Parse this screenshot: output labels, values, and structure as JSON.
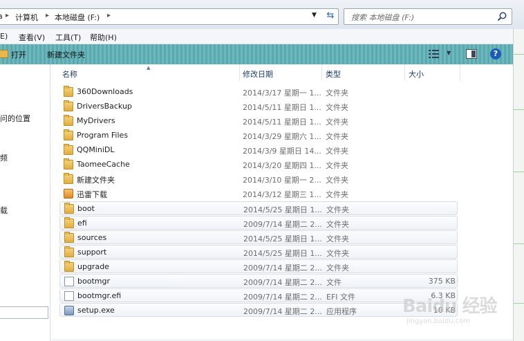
{
  "address_bar": {
    "segments": [
      "计算机",
      "本地磁盘 (F:)"
    ],
    "search_placeholder": "搜索 本地磁盘 (F:)",
    "partial_left": "a"
  },
  "menu": [
    "E)",
    "查看(V)",
    "工具(T)",
    "帮助(H)"
  ],
  "toolbar": {
    "open_label": "打开",
    "new_folder_label": "新建文件夹"
  },
  "nav_pane": [
    "问的位置",
    "频",
    "载"
  ],
  "columns": {
    "name": "名称",
    "date": "修改日期",
    "type": "类型",
    "size": "大小"
  },
  "files": [
    {
      "name": "360Downloads",
      "date": "2014/3/17 星期一 1...",
      "type": "文件夹",
      "size": "",
      "icon": "folder-icon",
      "selected": false
    },
    {
      "name": "DriversBackup",
      "date": "2014/5/11 星期日 1...",
      "type": "文件夹",
      "size": "",
      "icon": "folder-icon",
      "selected": false
    },
    {
      "name": "MyDrivers",
      "date": "2014/5/11 星期日 1...",
      "type": "文件夹",
      "size": "",
      "icon": "folder-icon",
      "selected": false
    },
    {
      "name": "Program Files",
      "date": "2014/3/29 星期六 1...",
      "type": "文件夹",
      "size": "",
      "icon": "folder-icon",
      "selected": false
    },
    {
      "name": "QQMiniDL",
      "date": "2014/3/9 星期日 14...",
      "type": "文件夹",
      "size": "",
      "icon": "folder-icon",
      "selected": false
    },
    {
      "name": "TaomeeCache",
      "date": "2014/3/20 星期四 1...",
      "type": "文件夹",
      "size": "",
      "icon": "folder-icon",
      "selected": false
    },
    {
      "name": "新建文件夹",
      "date": "2014/3/10 星期一 2...",
      "type": "文件夹",
      "size": "",
      "icon": "folder-icon",
      "selected": false
    },
    {
      "name": "迅雷下载",
      "date": "2014/3/12 星期三 1...",
      "type": "文件夹",
      "size": "",
      "icon": "xunlei-folder-icon",
      "selected": false
    },
    {
      "name": "boot",
      "date": "2014/5/25 星期日 1...",
      "type": "文件夹",
      "size": "",
      "icon": "folder-icon",
      "selected": true
    },
    {
      "name": "efi",
      "date": "2009/7/14 星期二 2...",
      "type": "文件夹",
      "size": "",
      "icon": "folder-icon",
      "selected": true
    },
    {
      "name": "sources",
      "date": "2014/5/25 星期日 1...",
      "type": "文件夹",
      "size": "",
      "icon": "folder-icon",
      "selected": true
    },
    {
      "name": "support",
      "date": "2014/5/25 星期日 1...",
      "type": "文件夹",
      "size": "",
      "icon": "folder-icon",
      "selected": true
    },
    {
      "name": "upgrade",
      "date": "2009/7/14 星期二 2...",
      "type": "文件夹",
      "size": "",
      "icon": "folder-icon",
      "selected": true
    },
    {
      "name": "bootmgr",
      "date": "2009/7/14 星期二 2...",
      "type": "文件",
      "size": "375 KB",
      "icon": "file-icon",
      "selected": true
    },
    {
      "name": "bootmgr.efi",
      "date": "2009/7/14 星期二 2...",
      "type": "EFI 文件",
      "size": "6.3 KB",
      "icon": "file-icon",
      "selected": true
    },
    {
      "name": "setup.exe",
      "date": "2009/7/14 星期二 2...",
      "type": "应用程序",
      "size": "10 KB",
      "icon": "exe-icon",
      "selected": true
    }
  ],
  "watermark": {
    "line1": "Baidu 经验",
    "line2": "jingyan.baidu.com"
  },
  "colors": {
    "toolbar": "#5aa9ae",
    "header_text": "#1e3e6e",
    "folder": "#e2ad3c"
  }
}
